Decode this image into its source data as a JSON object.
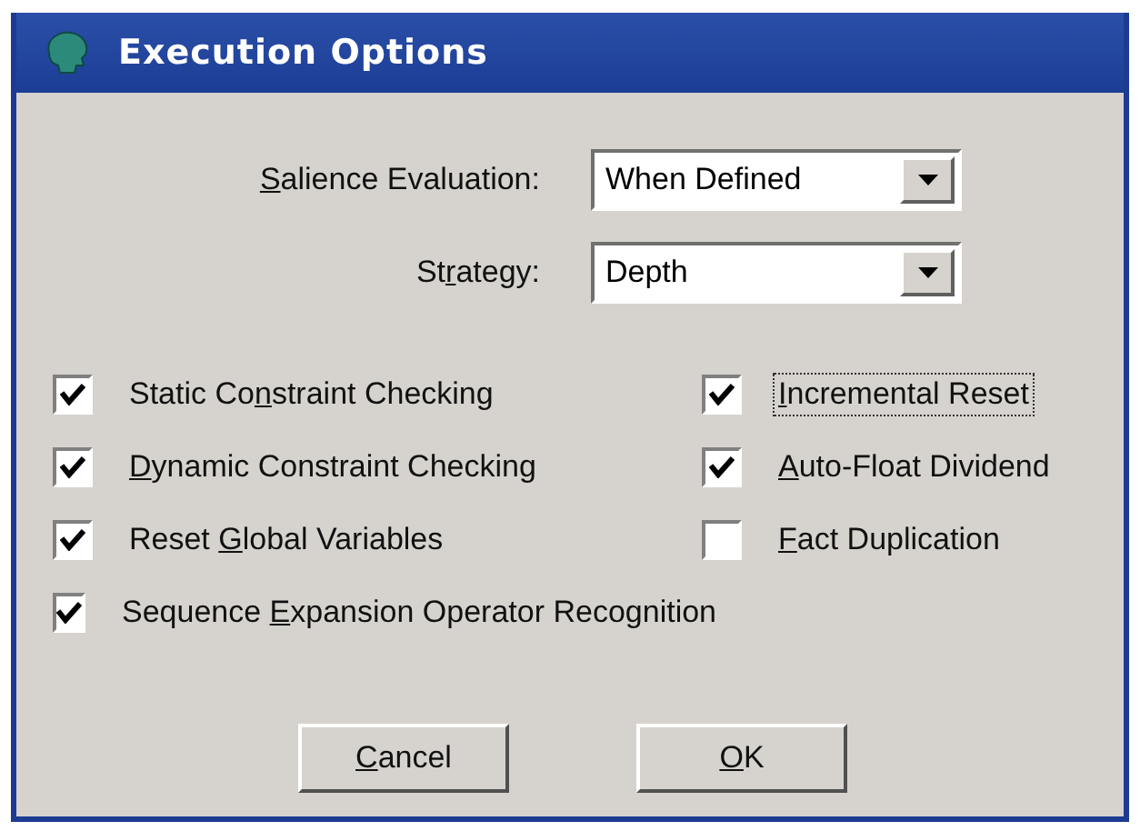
{
  "window": {
    "title": "Execution Options"
  },
  "fields": [
    {
      "label": {
        "key": "S",
        "post": "alience Evaluation:"
      },
      "value": "When Defined"
    },
    {
      "label": {
        "pre": "St",
        "key": "r",
        "post": "ategy:"
      },
      "value": "Depth"
    }
  ],
  "options_left": [
    {
      "label": {
        "pre": "Static Co",
        "key": "n",
        "post": "straint Checking"
      },
      "checked": true,
      "focused": false
    },
    {
      "label": {
        "key": "D",
        "post": "ynamic Constraint Checking"
      },
      "checked": true,
      "focused": false
    },
    {
      "label": {
        "pre": "Reset ",
        "key": "G",
        "post": "lobal Variables"
      },
      "checked": true,
      "focused": false
    },
    {
      "label": {
        "pre": "Sequence ",
        "key": "E",
        "post": "xpansion Operator Recognition"
      },
      "checked": true,
      "focused": false
    }
  ],
  "options_right": [
    {
      "label": {
        "key": "I",
        "post": "ncremental Reset"
      },
      "checked": true,
      "focused": true
    },
    {
      "label": {
        "key": "A",
        "post": "uto-Float Dividend"
      },
      "checked": true,
      "focused": false
    },
    {
      "label": {
        "key": "F",
        "post": "act Duplication"
      },
      "checked": false,
      "focused": false
    }
  ],
  "buttons": [
    {
      "label": {
        "key": "C",
        "post": "ancel"
      }
    },
    {
      "label": {
        "key": "O",
        "post": "K"
      }
    }
  ]
}
